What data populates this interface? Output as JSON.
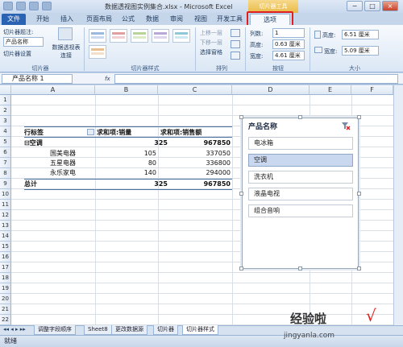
{
  "window": {
    "title": "数据透视图实例集合.xlsx - Microsoft Excel",
    "context_tool": "切片器工具",
    "min": "−",
    "max": "□",
    "close": "×"
  },
  "tabs": [
    "文件",
    "开始",
    "插入",
    "页面布局",
    "公式",
    "数据",
    "审阅",
    "视图",
    "开发工具",
    "选项"
  ],
  "ribbon": {
    "slicer_caption_label": "切片器题注:",
    "slicer_caption_value": "产品名称",
    "slicer_settings": "切片器设置",
    "pivot_connections": "数据透视表连接",
    "group_slicer": "切片器",
    "group_styles": "切片器样式",
    "bring_forward": "上移一层",
    "send_backward": "下移一层",
    "selection_pane": "选择窗格",
    "group_arrange": "排列",
    "columns_label": "列数:",
    "columns_value": "1",
    "height_label": "高度:",
    "height_value": "0.63 厘米",
    "width_label": "宽度:",
    "width_value": "4.61 厘米",
    "group_buttons": "按钮",
    "size_height_label": "高度:",
    "size_height_value": "6.51 厘米",
    "size_width_label": "宽度:",
    "size_width_value": "5.09 厘米",
    "group_size": "大小"
  },
  "formula_bar": {
    "name_box": "产品名称 1",
    "fx": "fx",
    "content": ""
  },
  "columns": [
    "A",
    "B",
    "C",
    "D",
    "E",
    "F"
  ],
  "rows": [
    "1",
    "2",
    "3",
    "4",
    "5",
    "6",
    "7",
    "8",
    "9",
    "10",
    "11",
    "12",
    "13",
    "14",
    "15",
    "16",
    "17",
    "18",
    "19",
    "20",
    "21",
    "22"
  ],
  "pivot": {
    "header_label": "行标签",
    "header_qty": "求和项:销量",
    "header_amount": "求和项:销售额",
    "group_name": "⊟空调",
    "group_qty": "325",
    "group_amount": "967850",
    "items": [
      {
        "name": "国美电器",
        "qty": "105",
        "amount": "337050"
      },
      {
        "name": "五星电器",
        "qty": "80",
        "amount": "336800"
      },
      {
        "name": "永乐家电",
        "qty": "140",
        "amount": "294000"
      }
    ],
    "total_label": "总计",
    "total_qty": "325",
    "total_amount": "967850"
  },
  "slicer": {
    "title": "产品名称",
    "items": [
      "电冰箱",
      "空调",
      "洗衣机",
      "液晶电视",
      "组合音响"
    ],
    "selected_index": 1
  },
  "sheet_tabs": [
    "调整字段顺序",
    "Sheet8",
    "更改数据源",
    "切片器",
    "切片器样式"
  ],
  "active_sheet_index": 4,
  "status": "就绪",
  "watermark": {
    "text": "经验啦",
    "check": "√",
    "url": "jingyanla.com"
  }
}
